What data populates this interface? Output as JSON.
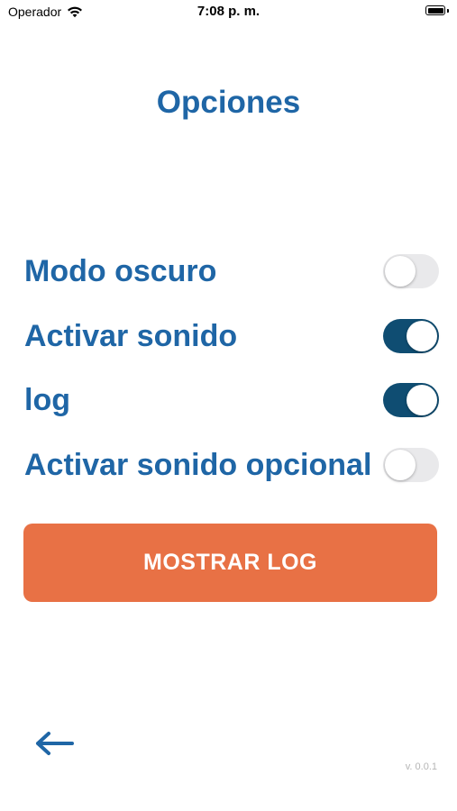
{
  "status_bar": {
    "carrier": "Operador",
    "time": "7:08 p. m."
  },
  "title": "Opciones",
  "options": [
    {
      "label": "Modo oscuro",
      "enabled": false
    },
    {
      "label": "Activar sonido",
      "enabled": true
    },
    {
      "label": "log",
      "enabled": true
    },
    {
      "label": "Activar sonido opcional",
      "enabled": false
    }
  ],
  "show_log_button": "MOSTRAR LOG",
  "version": "v. 0.0.1",
  "colors": {
    "title": "#1f66a6",
    "toggle_on": "#0f4d72",
    "toggle_off": "#e9e9eb",
    "button": "#e87145"
  }
}
